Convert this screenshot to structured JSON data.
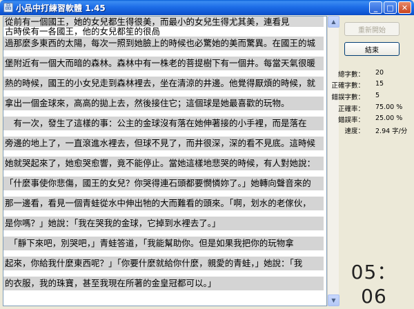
{
  "window": {
    "title": "小品中打練習軟體 1.45",
    "icon_glyph": "品",
    "minimize_glyph": "_",
    "maximize_glyph": "□",
    "close_glyph": "✕"
  },
  "practice": {
    "lines": [
      {
        "source": "從前有一個國王，她的女兒都生得很美，而最小的女兒生得尤其美，連看見",
        "typed": "古時侯有一各國王，他的女兒都笙的很咼"
      },
      {
        "source": "過那麼多東西的太陽，每次一照到她臉上的時候也必驚她的美而驚異。在國王的城",
        "typed": ""
      },
      {
        "source": "堡附近有一個大而暗的森林。森林中有一株老的菩提樹下有一個井。每當天氣很暖",
        "typed": ""
      },
      {
        "source": "熱的時候，國王的小女兒走到森林裡去，坐在清涼的井邊。他覺得厭煩的時候，就",
        "typed": ""
      },
      {
        "source": "拿出一個金球來，高高的拋上去，然後接住它；這個球是她最喜歡的玩物。",
        "typed": ""
      },
      {
        "source": "　有一次，發生了這樣的事：公主的金球沒有落在她伸著接的小手裡，而是落在",
        "typed": ""
      },
      {
        "source": "旁邊的地上了，一直滾進水裡去，但球不見了，而井很深，深的看不見底。這時候",
        "typed": ""
      },
      {
        "source": "她就哭起來了，她愈哭愈響，竟不能停止。當她這樣地悲哭的時候，有人對她說：",
        "typed": ""
      },
      {
        "source": "「什麼事使你悲傷，國王的女兒？你哭得連石頭都要憫憐妳了。」她轉向聲音來的",
        "typed": ""
      },
      {
        "source": "那一邊看，看見一個青蛙從水中伸出牠的大而難看的頭來。「啊，划水的老傢伙，",
        "typed": ""
      },
      {
        "source": "是你嗎？」她說：「我在哭我的金球，它掉到水裡去了。」",
        "typed": ""
      },
      {
        "source": "　「靜下來吧，別哭吧，」青蛙答道，「我能幫助你。但是如果我把你的玩物拿",
        "typed": ""
      },
      {
        "source": "起來，你給我什麼東西呢？」「你要什麼就給你什麼，親愛的青蛙，」她說：「我",
        "typed": ""
      },
      {
        "source": "的衣服，我的珠寶，甚至我現在所著的金皇冠都可以。」",
        "typed": ""
      }
    ]
  },
  "controls": {
    "restart_label": "重新開始",
    "end_label": "結束"
  },
  "stats": {
    "total_chars_label": "總字數：",
    "total_chars": "20",
    "correct_chars_label": "正確字數：",
    "correct_chars": "15",
    "wrong_chars_label": "錯誤字數：",
    "wrong_chars": "5",
    "accuracy_label": "正確率：",
    "accuracy": "75.00 %",
    "error_rate_label": "錯誤率：",
    "error_rate": "25.00 %",
    "speed_label": "速度：",
    "speed": "2.94 字/分"
  },
  "timer": "05：06"
}
